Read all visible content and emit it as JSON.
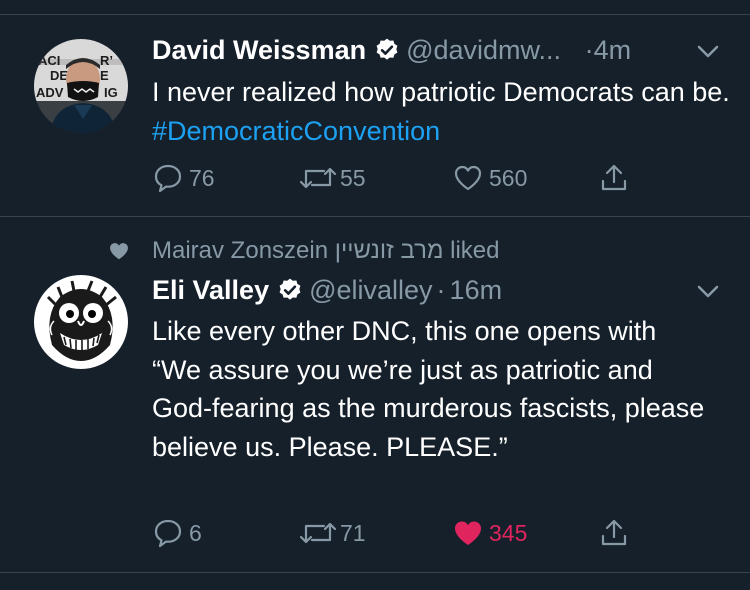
{
  "tweets": [
    {
      "author": "David Weissman",
      "handle": "@davidmw...",
      "dot": "·",
      "time": "4m",
      "text_plain": "I never realized how patriotic Democrats can be. ",
      "hashtag": "#DemocraticConvention",
      "replies": "76",
      "retweets": "55",
      "likes": "560",
      "avatar_mask_text": "ACI R’ DE E ADV IG"
    },
    {
      "social_context": "Mairav Zonszein מרב זונשיין liked",
      "author": "Eli Valley",
      "handle": "@elivalley",
      "dot": "·",
      "time": "16m",
      "text": "Like every other DNC, this one opens with “We assure you we’re just as patriotic and God-fearing as the murderous fascists, please believe us. Please. PLEASE.”",
      "replies": "6",
      "retweets": "71",
      "likes": "345",
      "liked": true
    }
  ],
  "colors": {
    "background": "#15202b",
    "text": "#ffffff",
    "secondary": "#8899a6",
    "link": "#1da1f2",
    "like": "#e0245e",
    "divider": "#38444d"
  },
  "icons": [
    "verified-badge-icon",
    "chevron-down-icon",
    "reply-icon",
    "retweet-icon",
    "like-icon",
    "share-icon"
  ]
}
